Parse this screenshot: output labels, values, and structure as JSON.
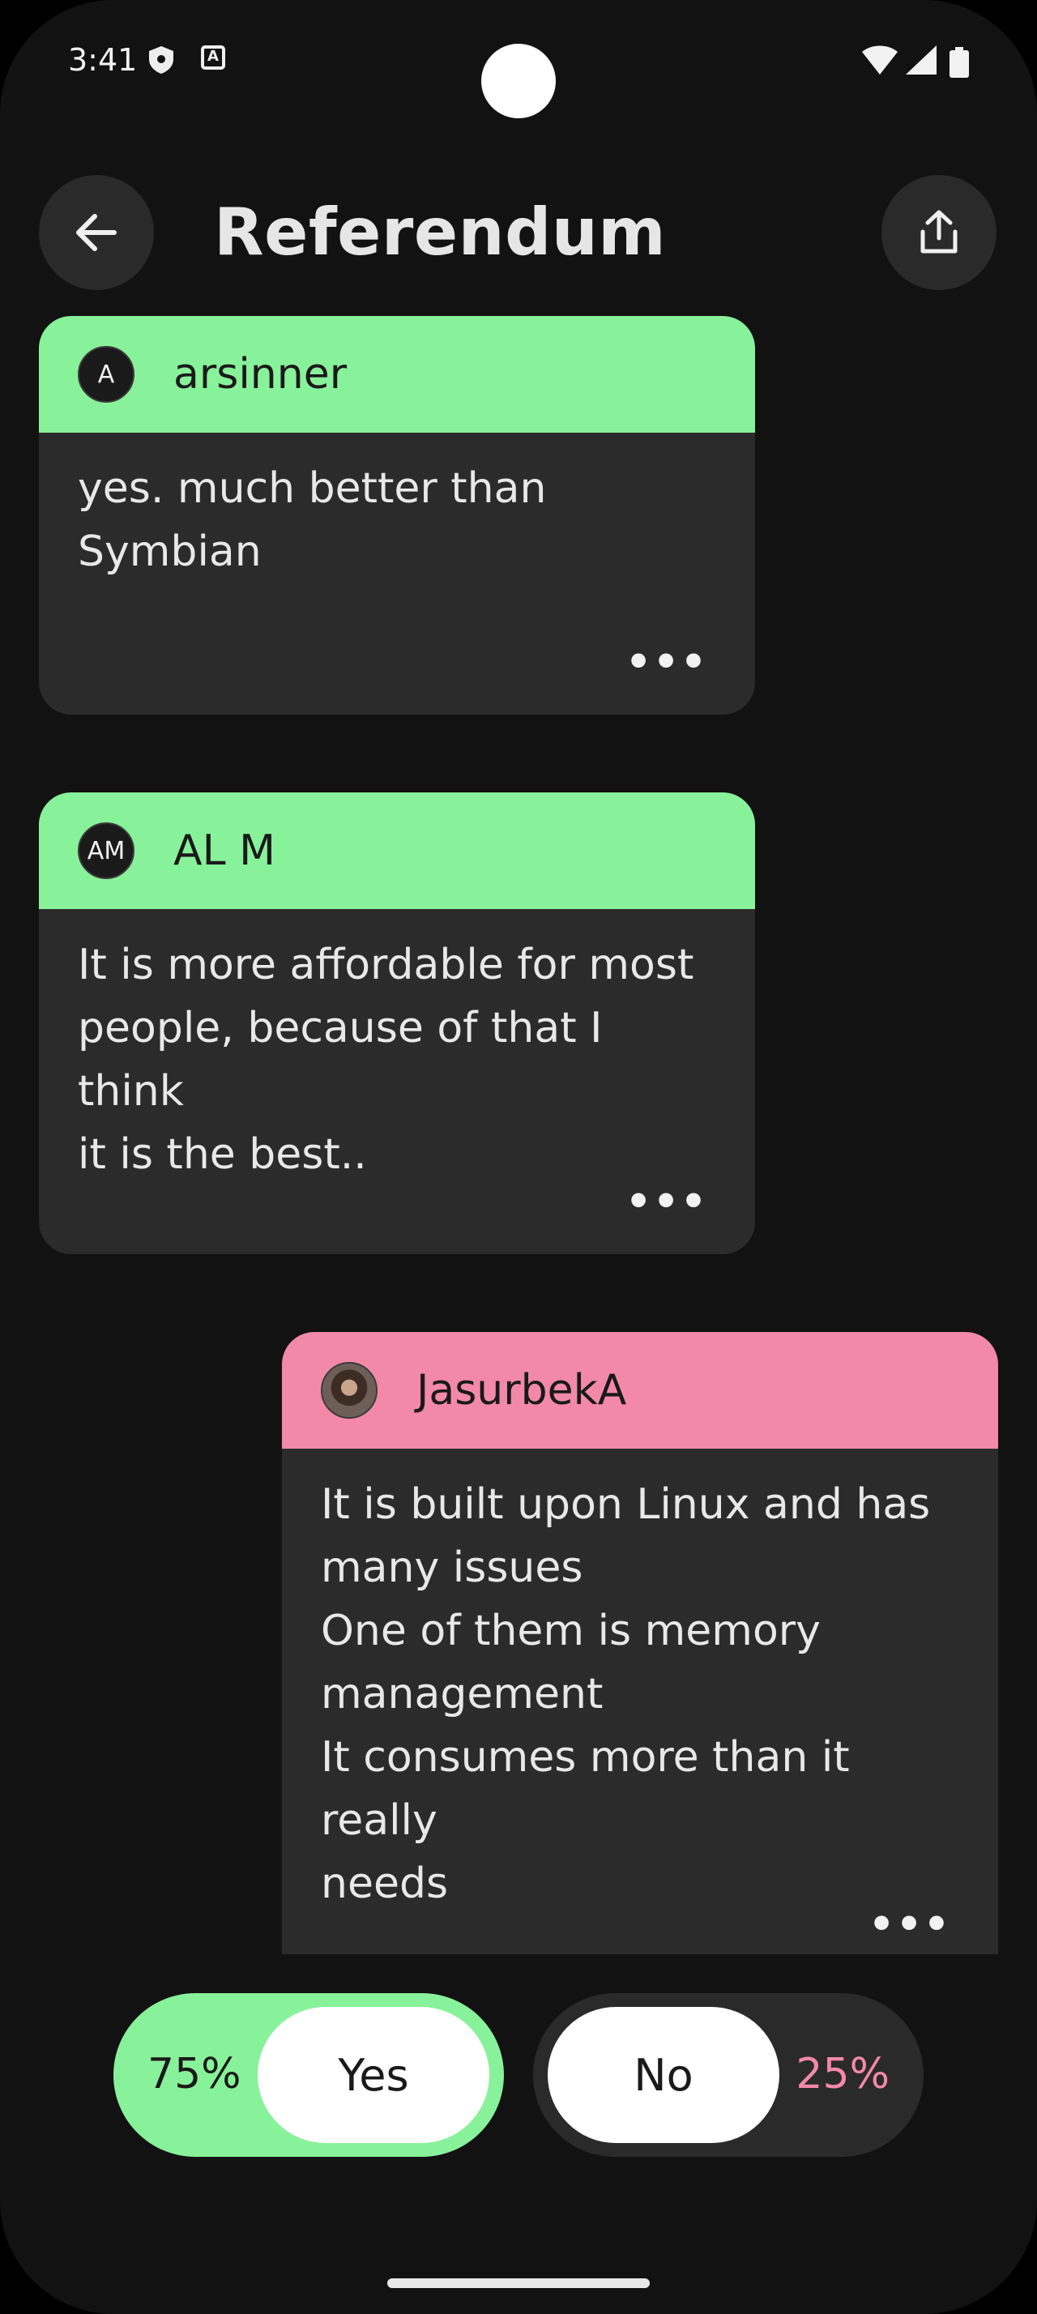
{
  "status_bar": {
    "time": "3:41",
    "icons": [
      "shield-icon",
      "a-badge-icon",
      "wifi-icon",
      "signal-icon",
      "battery-icon"
    ]
  },
  "header": {
    "title": "Referendum",
    "back_icon": "arrow-back-icon",
    "share_icon": "share-icon"
  },
  "comments": [
    {
      "avatar_text": "A",
      "username": "arsinner",
      "side": "yes",
      "body": "yes. much better than\nSymbian",
      "more": "•••"
    },
    {
      "avatar_text": "AM",
      "username": "AL M",
      "side": "yes",
      "body": "It is more affordable for most\npeople, because of that I think\nit is the best..",
      "more": "•••"
    },
    {
      "avatar_text": "",
      "username": "JasurbekA",
      "side": "no",
      "body": "It is built upon Linux and has\nmany issues\nOne of them is memory\nmanagement\nIt consumes more than it really\nneeds",
      "more": "•••"
    }
  ],
  "vote": {
    "yes_percent": "75%",
    "yes_label": "Yes",
    "no_label": "No",
    "no_percent": "25%"
  },
  "colors": {
    "yes": "#88f29a",
    "no": "#f389a9",
    "background": "#121212",
    "card": "#2b2b2b"
  }
}
